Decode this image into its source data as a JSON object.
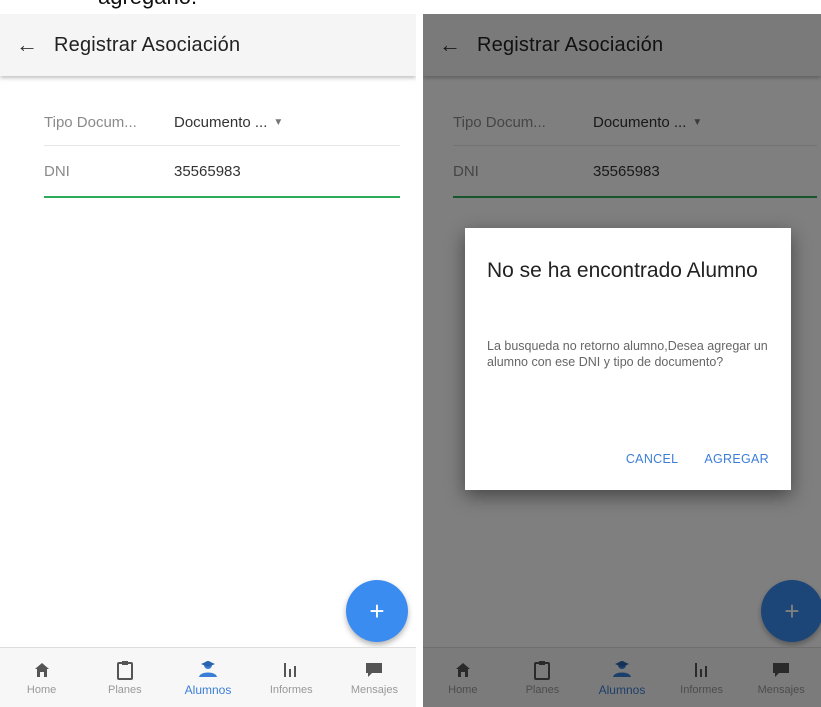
{
  "caption": "agregarlo.",
  "screen": {
    "title": "Registrar Asociación",
    "form": {
      "tipo_label": "Tipo Docum...",
      "tipo_value": "Documento ...",
      "dni_label": "DNI",
      "dni_value": "35565983"
    },
    "fab_icon": "+",
    "nav": [
      {
        "label": "Home",
        "icon": "home-icon"
      },
      {
        "label": "Planes",
        "icon": "clipboard-icon"
      },
      {
        "label": "Alumnos",
        "icon": "students-icon"
      },
      {
        "label": "Informes",
        "icon": "bar-chart-icon"
      },
      {
        "label": "Mensajes",
        "icon": "message-icon"
      }
    ],
    "active_nav": "Alumnos"
  },
  "dialog": {
    "title": "No se ha encontrado Alumno",
    "body": "La busqueda no retorno alumno,Desea agregar un alumno con ese DNI y tipo de documento?",
    "cancel_label": "CANCEL",
    "confirm_label": "AGREGAR"
  },
  "colors": {
    "accent": "#3b7ed6",
    "fab": "#3b8cf0",
    "underline": "#2eab5a"
  }
}
